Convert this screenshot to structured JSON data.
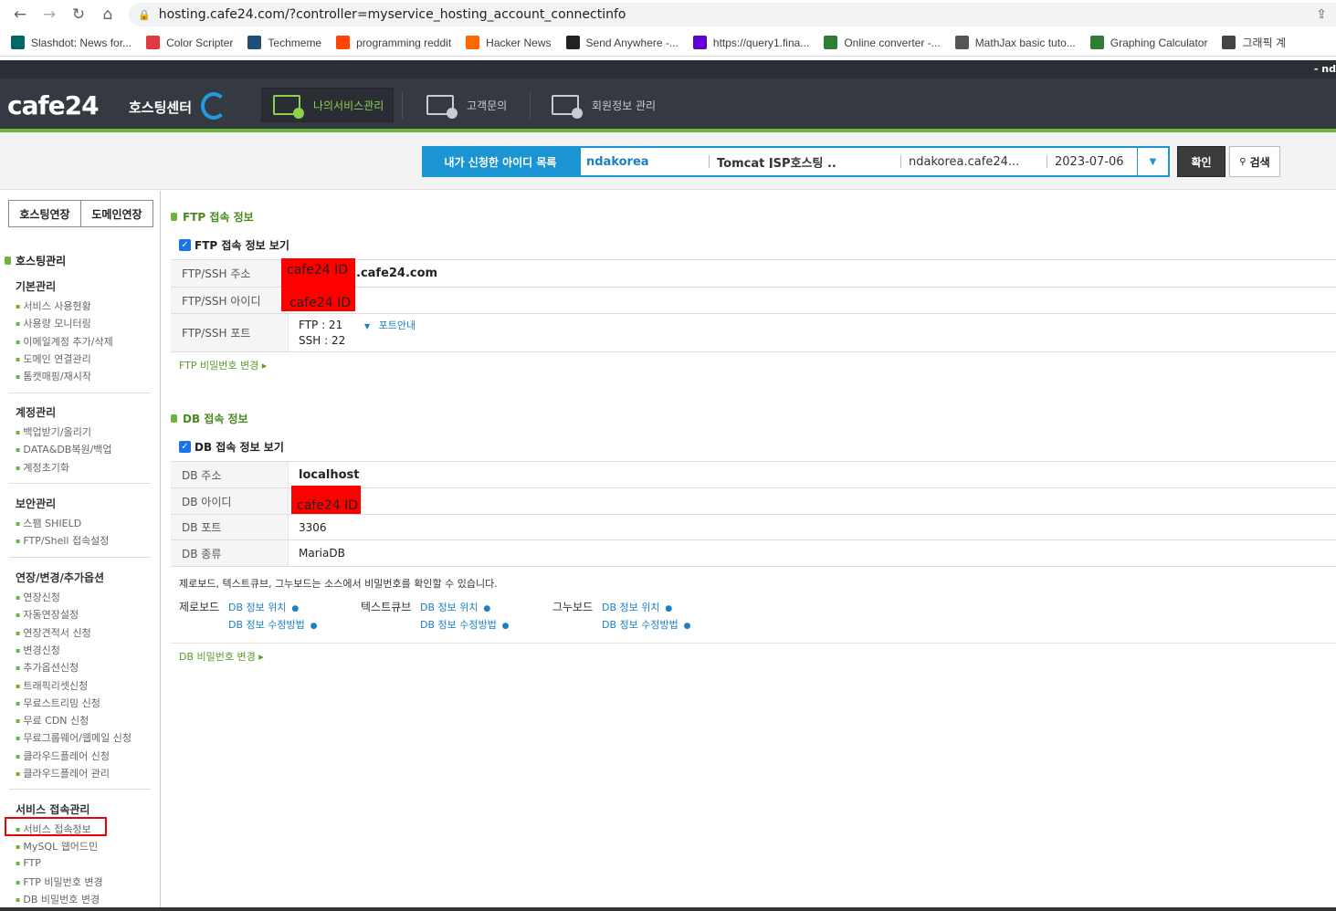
{
  "browser": {
    "url": "hosting.cafe24.com/?controller=myservice_hosting_account_connectinfo",
    "bookmarks": [
      {
        "label": "Slashdot: News for...",
        "icon": "slashdot-icon",
        "color": "#006666"
      },
      {
        "label": "Color Scripter",
        "icon": "color-scripter-icon",
        "color": "#e0393e"
      },
      {
        "label": "Techmeme",
        "icon": "techmeme-icon",
        "color": "#1f4e79"
      },
      {
        "label": "programming reddit",
        "icon": "reddit-icon",
        "color": "#ff4500"
      },
      {
        "label": "Hacker News",
        "icon": "hacker-news-icon",
        "color": "#ff6600"
      },
      {
        "label": "Send Anywhere -...",
        "icon": "send-anywhere-icon",
        "color": "#222222"
      },
      {
        "label": "https://query1.fina...",
        "icon": "yahoo-icon",
        "color": "#6001d2"
      },
      {
        "label": "Online converter -...",
        "icon": "converter-icon",
        "color": "#2e7d32"
      },
      {
        "label": "MathJax basic tuto...",
        "icon": "mathjax-icon",
        "color": "#555555"
      },
      {
        "label": "Graphing Calculator",
        "icon": "desmos-icon",
        "color": "#2e7d32"
      },
      {
        "label": "그래픽 계",
        "icon": "graph-icon",
        "color": "#444444"
      }
    ]
  },
  "header": {
    "logo": "cafe24",
    "logo_sub": "호스팅센터",
    "user": "- nd",
    "nav": [
      {
        "label": "나의서비스관리"
      },
      {
        "label": "고객문의"
      },
      {
        "label": "회원정보 관리"
      }
    ]
  },
  "id_selector": {
    "label": "내가 신청한 아이디 목록",
    "account_id": "ndakorea",
    "product": "Tomcat JSP호스팅 ..",
    "domain": "ndakorea.cafe24...",
    "date": "2023-07-06",
    "confirm": "확인",
    "search": "검색"
  },
  "sidebar": {
    "btn_hosting_renew": "호스팅연장",
    "btn_domain_renew": "도메인연장",
    "title": "호스팅관리",
    "groups": [
      {
        "title": "기본관리",
        "items": [
          "서비스 사용현황",
          "사용량 모니터링",
          "이메일계정 추가/삭제",
          "도메인 연결관리",
          "톰캣매핑/재시작"
        ]
      },
      {
        "title": "계정관리",
        "items": [
          "백업받기/올리기",
          "DATA&DB복원/백업",
          "계정초기화"
        ]
      },
      {
        "title": "보안관리",
        "items": [
          "스팸 SHIELD",
          "FTP/Shell 접속설정"
        ]
      },
      {
        "title": "연장/변경/추가옵션",
        "items": [
          "연장신청",
          "자동연장설정",
          "연장견적서 신청",
          "변경신청",
          "추가옵션신청",
          "트래픽리셋신청",
          "무료스트리밍 신청",
          "무료 CDN 신청",
          "무료그룹웨어/웹메일 신청",
          "클라우드플레어 신청",
          "클라우드플레어 관리"
        ]
      },
      {
        "title": "서비스 접속관리",
        "items": [
          "서비스 접속정보",
          "MySQL 웹어드민",
          "FTP",
          "FTP 비밀번호 변경",
          "DB 비밀번호 변경"
        ]
      }
    ]
  },
  "ftp": {
    "section_title": "FTP 접속 정보",
    "checkbox_label": "FTP 접속 정보 보기",
    "rows": [
      {
        "label": "FTP/SSH 주소",
        "value": ".cafe24.com"
      },
      {
        "label": "FTP/SSH 아이디",
        "value": ""
      },
      {
        "label": "FTP/SSH 포트",
        "value": "FTP : 21",
        "value2": "SSH : 22"
      }
    ],
    "port_guide": "포트안내",
    "redact_text": "cafe24 ID",
    "change_pw": "FTP 비밀번호 변경"
  },
  "db": {
    "section_title": "DB 접속 정보",
    "checkbox_label": "DB 접속 정보 보기",
    "rows": [
      {
        "label": "DB 주소",
        "value": "localhost"
      },
      {
        "label": "DB 아이디",
        "value": ""
      },
      {
        "label": "DB 포트",
        "value": "3306"
      },
      {
        "label": "DB 종류",
        "value": "MariaDB"
      }
    ],
    "redact_text": "cafe24 ID",
    "note": "제로보드, 텍스트큐브, 그누보드는 소스에서 비밀번호를 확인할 수 있습니다.",
    "editors": [
      {
        "name": "제로보드",
        "link1": "DB 정보 위치",
        "link2": "DB 정보 수정방법"
      },
      {
        "name": "텍스트큐브",
        "link1": "DB 정보 위치",
        "link2": "DB 정보 수정방법"
      },
      {
        "name": "그누보드",
        "link1": "DB 정보 위치",
        "link2": "DB 정보 수정방법"
      }
    ],
    "change_pw": "DB 비밀번호 변경"
  }
}
